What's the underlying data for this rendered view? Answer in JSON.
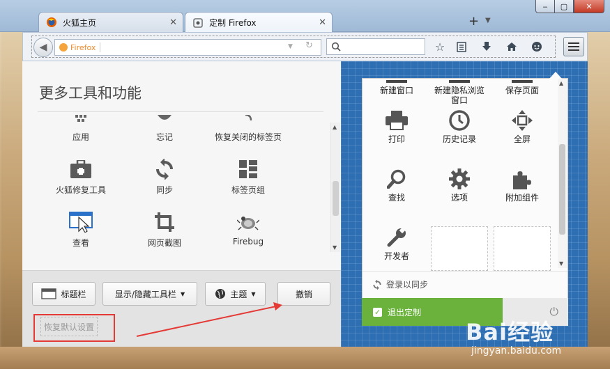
{
  "tabs": [
    {
      "label": "火狐主页",
      "active": false
    },
    {
      "label": "定制 Firefox",
      "active": true
    }
  ],
  "window_controls": {
    "minimize": "‒",
    "maximize": "▢",
    "close": "✕"
  },
  "navbar": {
    "url_placeholder": "Firefox",
    "search_placeholder": ""
  },
  "left_panel": {
    "title": "更多工具和功能",
    "items": [
      {
        "label": "应用",
        "icon": "apps-icon"
      },
      {
        "label": "忘记",
        "icon": "forget-icon"
      },
      {
        "label": "恢复关闭的标签页",
        "icon": "restore-tab-icon"
      },
      {
        "label": "火狐修复工具",
        "icon": "toolbox-icon"
      },
      {
        "label": "同步",
        "icon": "sync-icon"
      },
      {
        "label": "标签页组",
        "icon": "tab-groups-icon"
      },
      {
        "label": "查看",
        "icon": "view-icon"
      },
      {
        "label": "网页截图",
        "icon": "crop-icon"
      },
      {
        "label": "Firebug",
        "icon": "firebug-icon"
      }
    ]
  },
  "bottom_bar": {
    "titlebar_label": "标题栏",
    "toolbars_label": "显示/隐藏工具栏",
    "themes_label": "主题",
    "undo_label": "撤销",
    "restore_defaults_label": "恢复默认设置"
  },
  "menu_panel": {
    "items": [
      {
        "label": "新建窗口",
        "icon": "new-window-icon"
      },
      {
        "label": "新建隐私浏览窗口",
        "icon": "private-window-icon"
      },
      {
        "label": "保存页面",
        "icon": "save-page-icon"
      },
      {
        "label": "打印",
        "icon": "print-icon"
      },
      {
        "label": "历史记录",
        "icon": "history-icon"
      },
      {
        "label": "全屏",
        "icon": "fullscreen-icon"
      },
      {
        "label": "查找",
        "icon": "find-icon"
      },
      {
        "label": "选项",
        "icon": "options-icon"
      },
      {
        "label": "附加组件",
        "icon": "addons-icon"
      },
      {
        "label": "开发者",
        "icon": "developer-icon"
      }
    ],
    "sync_label": "登录以同步",
    "exit_label": "退出定制"
  },
  "watermark": {
    "brand": "Bai经验",
    "sub": "jingyan.baidu.com"
  },
  "colors": {
    "accent_green": "#6ab23c",
    "blueprint": "#2e6fb4",
    "annotation_red": "#e53935"
  }
}
